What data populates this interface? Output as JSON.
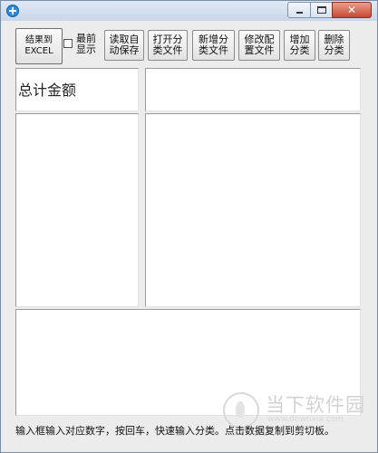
{
  "window": {
    "title": "",
    "controls": {
      "minimize_icon": "minimize-icon",
      "maximize_icon": "maximize-icon",
      "close_glyph": "✕"
    }
  },
  "toolbar": {
    "export_excel": "结果到\nEXCEL",
    "always_on_top": {
      "label": "最前\n显示",
      "checked": false
    },
    "read_autosave": "读取自\n动保存",
    "open_category_file": "打开分\n类文件",
    "new_category_file": "新增分\n类文件",
    "modify_config_file": "修改配\n置文件",
    "add_category": "增加\n分类",
    "delete_category": "删除\n分类"
  },
  "panels": {
    "total_label": "总计金额"
  },
  "status_bar": {
    "text": "输入框输入对应数字，按回车，快速输入分类。点击数据复制到剪切板。"
  },
  "watermark": {
    "text": "当下软件园",
    "url": "www.downxia.com"
  },
  "colors": {
    "accent": "#2c8be0",
    "close_button": "#c9472f"
  }
}
